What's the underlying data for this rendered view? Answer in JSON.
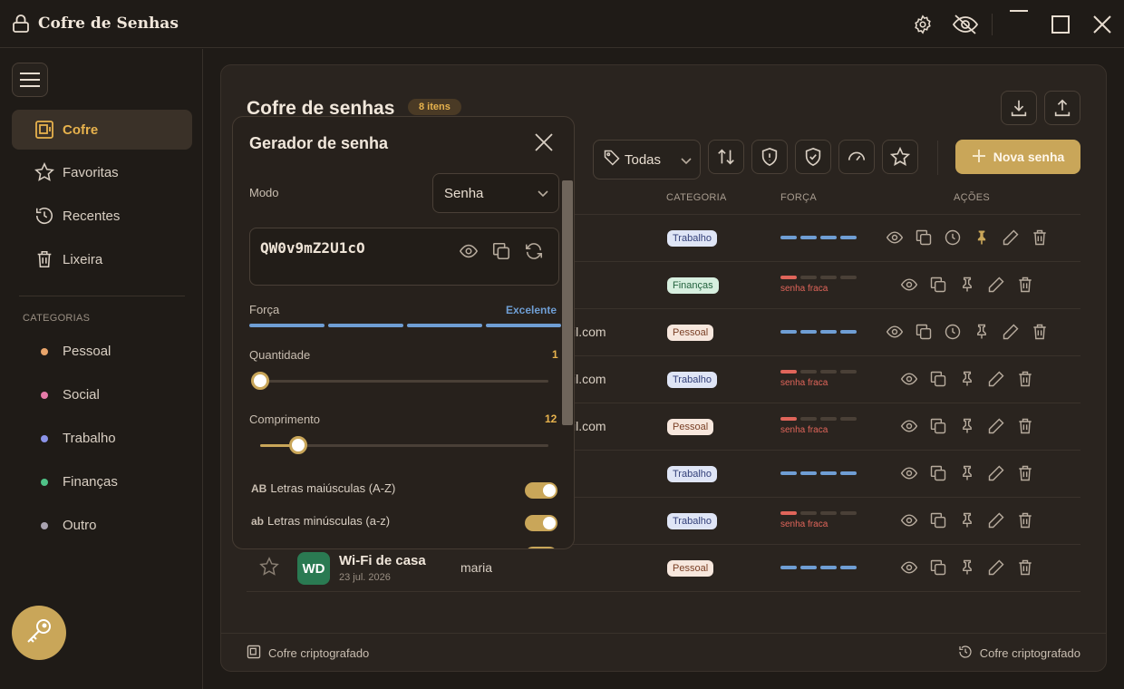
{
  "app": {
    "title": "Cofre de Senhas"
  },
  "sidebar": {
    "nav": [
      {
        "label": "Cofre"
      },
      {
        "label": "Favoritas"
      },
      {
        "label": "Recentes"
      },
      {
        "label": "Lixeira"
      }
    ],
    "categories_label": "CATEGORIAS",
    "categories": [
      {
        "label": "Pessoal",
        "color": "#e8a46a"
      },
      {
        "label": "Social",
        "color": "#e57aa8"
      },
      {
        "label": "Trabalho",
        "color": "#8b93e8"
      },
      {
        "label": "Finanças",
        "color": "#4fc287"
      },
      {
        "label": "Outro",
        "color": "#a9a3b0"
      }
    ]
  },
  "main": {
    "title": "Cofre de senhas",
    "count": "8 itens",
    "filter": "Todas",
    "new_button": "Nova senha",
    "columns": {
      "category": "CATEGORIA",
      "strength": "FORÇA",
      "actions": "AÇÕES"
    },
    "rows": [
      {
        "email_tail": "",
        "category": "Trabalho",
        "strength": "strong"
      },
      {
        "email_tail": "",
        "category": "Finanças",
        "strength": "weak",
        "weak_label": "senha fraca"
      },
      {
        "email_tail": "il.com",
        "category": "Pessoal",
        "strength": "strong"
      },
      {
        "email_tail": "il.com",
        "category": "Trabalho",
        "strength": "weak",
        "weak_label": "senha fraca"
      },
      {
        "email_tail": "il.com",
        "category": "Pessoal",
        "strength": "weak",
        "weak_label": "senha fraca"
      },
      {
        "email_tail": "",
        "category": "Trabalho",
        "strength": "strong"
      },
      {
        "email_tail": "",
        "category": "Trabalho",
        "strength": "weak",
        "weak_label": "senha fraca"
      },
      {
        "initials": "WD",
        "name": "Wi-Fi de casa",
        "date": "23 jul. 2026",
        "user": "maria",
        "category": "Pessoal",
        "strength": "strong"
      }
    ],
    "footer_left": "Cofre criptografado",
    "footer_right": "Cofre criptografado"
  },
  "generator": {
    "title": "Gerador de senha",
    "mode_label": "Modo",
    "mode_value": "Senha",
    "password": "QW0v9mZ2U1cO",
    "strength_label": "Força",
    "strength_value": "Excelente",
    "quantity_label": "Quantidade",
    "quantity_value": "1",
    "length_label": "Comprimento",
    "length_value": "12",
    "options": [
      {
        "icon_text": "AB",
        "label": "Letras maiúsculas (A-Z)",
        "enabled": true
      },
      {
        "icon_text": "ab",
        "label": "Letras minúsculas (a-z)",
        "enabled": true
      }
    ]
  },
  "colors": {
    "accent": "#c9a659",
    "strong": "#6f9ed4",
    "weak": "#e0655a"
  }
}
